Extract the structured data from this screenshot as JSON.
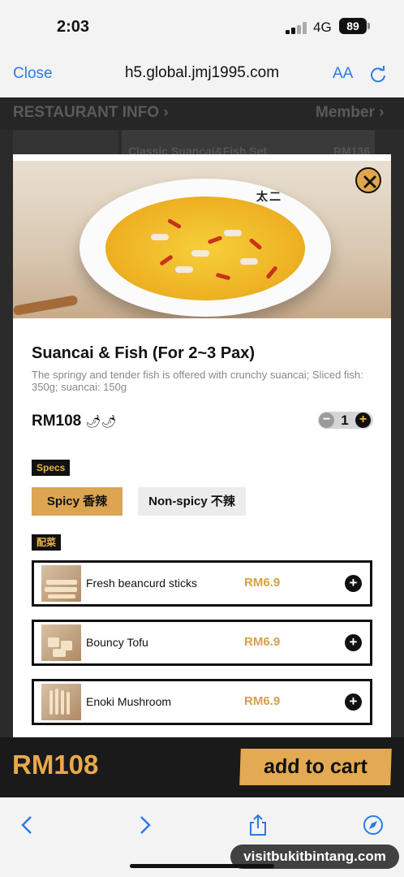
{
  "status_bar": {
    "time": "2:03",
    "network": "4G",
    "battery": "89"
  },
  "browser": {
    "close_label": "Close",
    "url": "h5.global.jmj1995.com",
    "text_size_label": "AA"
  },
  "background_page": {
    "tab_left": "RESTAURANT INFO",
    "tab_right": "Member",
    "item_name": "Classic Suancai&Fish Set",
    "item_price": "RM136"
  },
  "product": {
    "title": "Suancai & Fish (For 2~3 Pax)",
    "description": "The springy and tender fish is offered with crunchy suancai; Sliced fish: 350g; suancai: 150g",
    "price": "RM108",
    "spice_icons": "🌶🌶",
    "quantity": "1",
    "brand_mark": "太二"
  },
  "specs": {
    "label": "Specs",
    "options": [
      "Spicy 香辣",
      "Non-spicy 不辣"
    ],
    "selected": "Spicy 香辣"
  },
  "sides": {
    "label": "配菜",
    "items": [
      {
        "name": "Fresh beancurd sticks",
        "price": "RM6.9"
      },
      {
        "name": "Bouncy Tofu",
        "price": "RM6.9"
      },
      {
        "name": "Enoki Mushroom",
        "price": "RM6.9"
      }
    ]
  },
  "footer": {
    "total": "RM108",
    "add_to_cart_label": "add to cart"
  },
  "watermark": "visitbukitbintang.com",
  "colors": {
    "accent": "#e3aa53",
    "dark": "#1a1a1a",
    "link": "#2a7be6"
  }
}
